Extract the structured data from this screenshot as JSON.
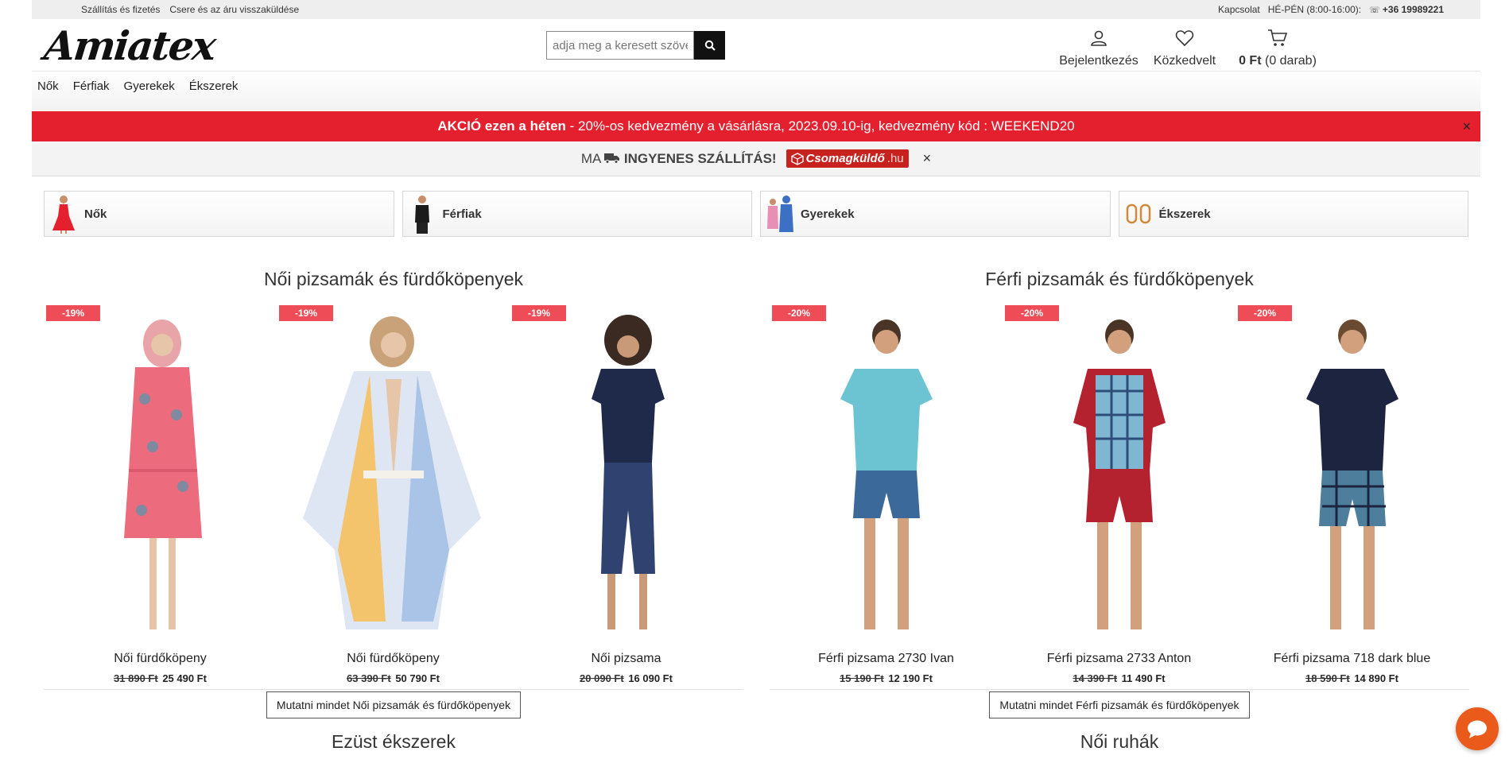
{
  "topbar": {
    "links": [
      "Szállítás és fizetés",
      "Csere és az áru visszaküldése"
    ],
    "contact": "Kapcsolat",
    "hours": "HÉ-PÉN (8:00-16:00):",
    "phone": "+36 19989221"
  },
  "header": {
    "logo": "Amiatex",
    "search_placeholder": "adja meg a keresett szöveg",
    "login_label": "Bejelentkezés",
    "favorites_label": "Közkedvelt",
    "cart_amount": "0 Ft",
    "cart_count": "(0 darab)"
  },
  "nav": {
    "items": [
      "Nők",
      "Férfiak",
      "Gyerekek",
      "Ékszerek"
    ]
  },
  "promo": {
    "bold": "AKCIÓ ezen a héten",
    "text": " - 20%-os kedvezmény a vásárlásra, 2023.09.10-ig, kedvezmény kód : WEEKEND20",
    "close": "×"
  },
  "shipping": {
    "prefix": "MA",
    "bold": "INGYENES SZÁLLÍTÁS!",
    "badge": "Csomagküldő",
    "badge_suffix": ".hu",
    "close": "×"
  },
  "categories": [
    "Nők",
    "Férfiak",
    "Gyerekek",
    "Ékszerek"
  ],
  "sections": {
    "left": {
      "title": "Női pizsamák és fürdőköpenyek",
      "products": [
        {
          "badge": "-19%",
          "name": "Női fürdőköpeny",
          "old_price": "31 890 Ft",
          "price": "25 490 Ft"
        },
        {
          "badge": "-19%",
          "name": "Női fürdőköpeny",
          "old_price": "63 390 Ft",
          "price": "50 790 Ft"
        },
        {
          "badge": "-19%",
          "name": "Női pizsama",
          "old_price": "20 090 Ft",
          "price": "16 090 Ft"
        }
      ],
      "show_all": "Mutatni mindet Női pizsamák és fürdőköpenyek",
      "next_title": "Ezüst ékszerek"
    },
    "right": {
      "title": "Férfi pizsamák és fürdőköpenyek",
      "products": [
        {
          "badge": "-20%",
          "name": "Férfi pizsama 2730 Ivan",
          "old_price": "15 190 Ft",
          "price": "12 190 Ft"
        },
        {
          "badge": "-20%",
          "name": "Férfi pizsama 2733 Anton",
          "old_price": "14 390 Ft",
          "price": "11 490 Ft"
        },
        {
          "badge": "-20%",
          "name": "Férfi pizsama 718 dark blue",
          "old_price": "18 590 Ft",
          "price": "14 890 Ft"
        }
      ],
      "show_all": "Mutatni mindet Férfi pizsamák és fürdőköpenyek",
      "next_title": "Női ruhák"
    }
  },
  "colors": {
    "promo_red": "#e4202f",
    "discount_badge": "#ee4d57",
    "chat_orange": "#ea5a1a"
  }
}
